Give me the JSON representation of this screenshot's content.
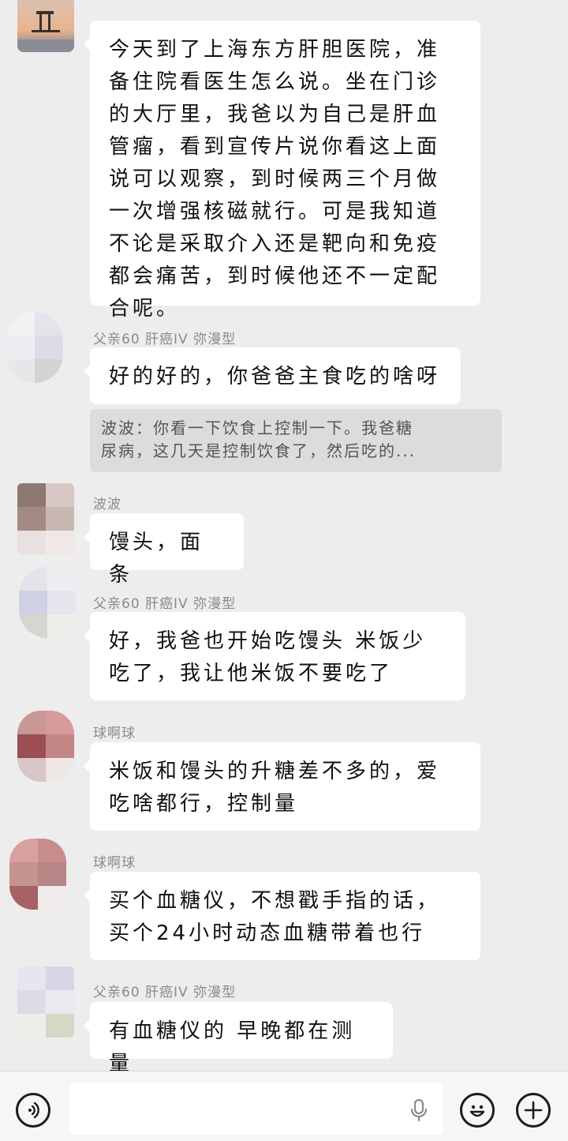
{
  "messages": [
    {
      "sender": "",
      "text": "今天到了上海东方肝胆医院，准备住院看医生怎么说。坐在门诊的大厅里，我爸以为自己是肝血管瘤，看到宣传片说你看这上面说可以观察，到时候两三个月做一次增强核磁就行。可是我知道不论是采取介入还是靶向和免疫都会痛苦，到时候他还不一定配合呢。"
    },
    {
      "sender": "父亲60 肝癌IV 弥漫型",
      "text": "好的好的，你爸爸主食吃的啥呀"
    },
    {
      "sender": "波波",
      "text": "馒头，面条"
    },
    {
      "sender": "父亲60 肝癌IV 弥漫型",
      "text": "好，我爸也开始吃馒头 米饭少吃了，我让他米饭不要吃了"
    },
    {
      "sender": "球啊球",
      "text": "米饭和馒头的升糖差不多的，爱吃啥都行，控制量"
    },
    {
      "sender": "球啊球",
      "text": "买个血糖仪，不想戳手指的话，买个24小时动态血糖带着也行"
    },
    {
      "sender": "父亲60 肝癌IV 弥漫型",
      "text": "有血糖仪的 早晚都在测量"
    }
  ],
  "quote": {
    "line1": "波波：你看一下饮食上控制一下。我爸糖",
    "line2": "尿病，这几天是控制饮食了，然后吃的..."
  },
  "input_bar": {
    "voice_icon": "voice-icon",
    "mic_icon": "mic-icon",
    "emoji_icon": "emoji-icon",
    "plus_icon": "plus-icon"
  },
  "colors": {
    "background": "#ededed",
    "bubble": "#ffffff",
    "quote_bg": "#dcdcdc"
  }
}
